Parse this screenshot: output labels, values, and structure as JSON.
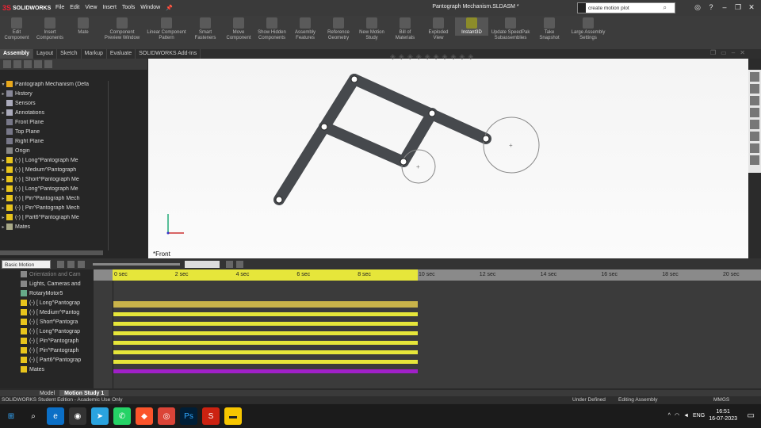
{
  "app": {
    "brand": "SOLIDWORKS",
    "brand_prefix": "3S"
  },
  "menu": [
    "File",
    "Edit",
    "View",
    "Insert",
    "Tools",
    "Window"
  ],
  "window_title": "Pantograph Mechanism.SLDASM *",
  "search": {
    "value": "create motion plot"
  },
  "ribbon": [
    "Edit Component",
    "Insert Components",
    "Mate",
    "Component Preview Window",
    "Linear Component Pattern",
    "Smart Fasteners",
    "Move Component",
    "Show Hidden Components",
    "Assembly Features",
    "Reference Geometry",
    "New Motion Study",
    "Bill of Materials",
    "Exploded View",
    "Instant3D",
    "Update SpeedPak Subassemblies",
    "Take Snapshot",
    "Large Assembly Settings"
  ],
  "cm_tabs": [
    "Assembly",
    "Layout",
    "Sketch",
    "Markup",
    "Evaluate",
    "SOLIDWORKS Add-Ins"
  ],
  "tree": [
    {
      "label": "Pantograph Mechanism (Defa",
      "exp": "▾"
    },
    {
      "label": "History",
      "exp": "▸"
    },
    {
      "label": "Sensors",
      "exp": ""
    },
    {
      "label": "Annotations",
      "exp": "▸"
    },
    {
      "label": "Front Plane",
      "exp": ""
    },
    {
      "label": "Top Plane",
      "exp": ""
    },
    {
      "label": "Right Plane",
      "exp": ""
    },
    {
      "label": "Origin",
      "exp": ""
    },
    {
      "label": "(-) [ Long^Pantograph Me",
      "exp": "▸"
    },
    {
      "label": "(-) [ Medium^Pantograph",
      "exp": "▸"
    },
    {
      "label": "(-) [ Short^Pantograph Me",
      "exp": "▸"
    },
    {
      "label": "(-) [ Long^Pantograph Me",
      "exp": "▸"
    },
    {
      "label": "(-) [ Pin^Pantograph Mech",
      "exp": "▸"
    },
    {
      "label": "(-) [ Pin^Pantograph Mech",
      "exp": "▸"
    },
    {
      "label": "(-) [ Part6^Pantograph Me",
      "exp": "▸"
    },
    {
      "label": "Mates",
      "exp": "▸"
    }
  ],
  "view_label": "*Front",
  "motion": {
    "type": "Basic Motion",
    "tree": [
      "Orientation and Cam",
      "Lights, Cameras and",
      "RotaryMotor5",
      "(-) [ Long^Pantograp",
      "(-) [ Medium^Pantog",
      "(-) [ Short^Pantogra",
      "(-) [ Long^Pantograp",
      "(-) [ Pin^Pantograph",
      "(-) [ Pin^Pantograph",
      "(-) [ Part6^Pantograp",
      "Mates"
    ],
    "ticks": [
      "0 sec",
      "2 sec",
      "4 sec",
      "6 sec",
      "8 sec",
      "10 sec",
      "12 sec",
      "14 sec",
      "16 sec",
      "18 sec",
      "20 sec"
    ]
  },
  "bottom_tabs": [
    "Model",
    "Motion Study 1"
  ],
  "status": {
    "left": "SOLIDWORKS Student Edition - Academic Use Only",
    "state": "Under Defined",
    "mode": "Editing Assembly",
    "units": "MMGS"
  },
  "taskbar": {
    "lang": "ENG",
    "time": "16:51",
    "date": "16-07-2023"
  },
  "colors": {
    "timeline_yellow": "#e6e63a",
    "motor_bar": "#c9b34a",
    "purple_bar": "#a020c8",
    "link": "#46494d"
  }
}
